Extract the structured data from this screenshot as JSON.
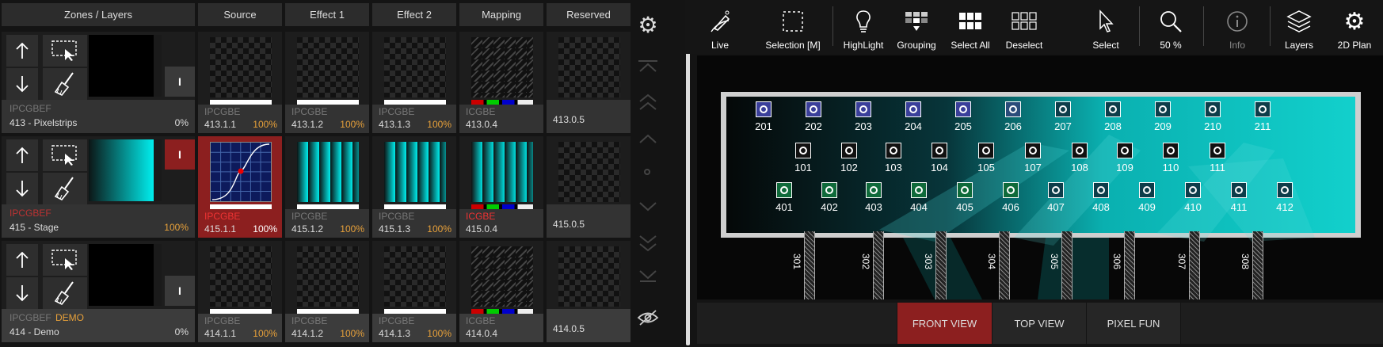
{
  "headers": {
    "zones": "Zones / Layers",
    "source": "Source",
    "effect1": "Effect 1",
    "effect2": "Effect 2",
    "mapping": "Mapping",
    "reserved": "Reserved"
  },
  "zones": [
    {
      "code": "IPCGBEF",
      "demo": "",
      "name": "413 - Pixelstrips",
      "pct": "0%",
      "toggle": "I"
    },
    {
      "code": "IPCGBEF",
      "demo": "",
      "name": "415 - Stage",
      "pct": "100%",
      "toggle": "I"
    },
    {
      "code": "IPCGBEF",
      "demo": "DEMO",
      "name": "414 - Demo",
      "pct": "0%",
      "toggle": "I"
    }
  ],
  "cells": [
    [
      {
        "code": "IPCGBE",
        "name": "413.1.1",
        "pct": "100%"
      },
      {
        "code": "IPCGBE",
        "name": "413.1.2",
        "pct": "100%"
      },
      {
        "code": "IPCGBE",
        "name": "413.1.3",
        "pct": "100%"
      },
      {
        "code": "ICGBE",
        "name": "413.0.4",
        "pct": ""
      },
      {
        "code": "",
        "name": "413.0.5",
        "pct": ""
      }
    ],
    [
      {
        "code": "IPCGBE",
        "name": "415.1.1",
        "pct": "100%"
      },
      {
        "code": "IPCGBE",
        "name": "415.1.2",
        "pct": "100%"
      },
      {
        "code": "IPCGBE",
        "name": "415.1.3",
        "pct": "100%"
      },
      {
        "code": "ICGBE",
        "name": "415.0.4",
        "pct": ""
      },
      {
        "code": "",
        "name": "415.0.5",
        "pct": ""
      }
    ],
    [
      {
        "code": "IPCGBE",
        "name": "414.1.1",
        "pct": "100%"
      },
      {
        "code": "IPCGBE",
        "name": "414.1.2",
        "pct": "100%"
      },
      {
        "code": "IPCGBE",
        "name": "414.1.3",
        "pct": "100%"
      },
      {
        "code": "ICGBE",
        "name": "414.0.4",
        "pct": ""
      },
      {
        "code": "",
        "name": "414.0.5",
        "pct": ""
      }
    ]
  ],
  "toolbar": {
    "live": "Live",
    "selection": "Selection [M]",
    "highlight": "HighLight",
    "grouping": "Grouping",
    "select_all": "Select All",
    "deselect": "Deselect",
    "select": "Select",
    "zoom": "50 %",
    "info": "Info",
    "layers": "Layers",
    "plan": "2D Plan"
  },
  "fixtures": {
    "row1": [
      "201",
      "202",
      "203",
      "204",
      "205",
      "206",
      "207",
      "208",
      "209",
      "210",
      "211"
    ],
    "row2": [
      "101",
      "102",
      "103",
      "104",
      "105",
      "107",
      "108",
      "109",
      "110",
      "111"
    ],
    "row3": [
      "401",
      "402",
      "403",
      "404",
      "405",
      "406",
      "407",
      "408",
      "409",
      "410",
      "411",
      "412"
    ],
    "truss": [
      "301",
      "302",
      "303",
      "304",
      "305",
      "306",
      "307",
      "308"
    ]
  },
  "views": {
    "front": "FRONT VIEW",
    "top": "TOP VIEW",
    "pixel": "PIXEL FUN"
  },
  "colors": {
    "accent_red": "#8c1f1f",
    "cyan": "#00e5e5",
    "orange": "#e8a13a"
  }
}
